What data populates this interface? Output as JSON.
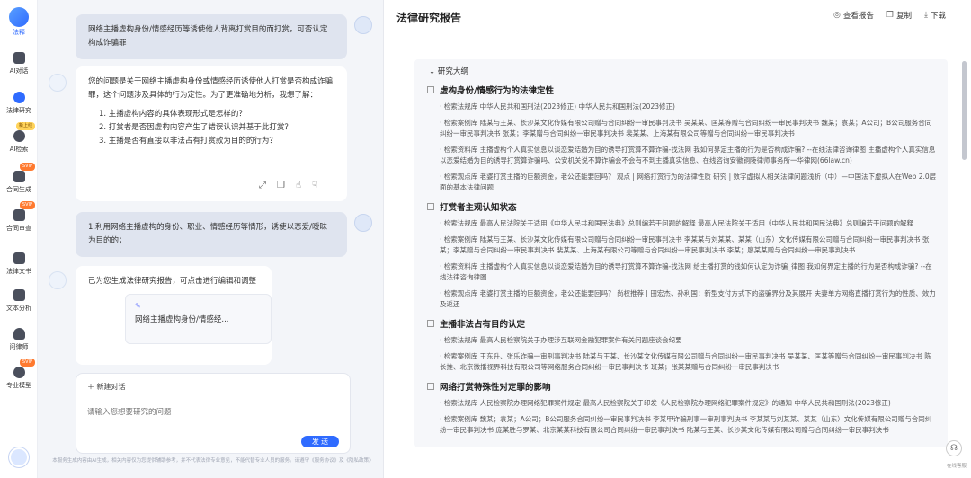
{
  "sidebar": {
    "logo_label": "法释",
    "items": [
      {
        "label": "AI对话",
        "icon": "chat-icon",
        "badge": ""
      },
      {
        "label": "法律研究",
        "icon": "research-icon",
        "badge": ""
      },
      {
        "label": "AI检索",
        "icon": "search-icon",
        "badge": "新上线"
      },
      {
        "label": "合同生成",
        "icon": "contract-gen-icon",
        "badge": "SVIP"
      },
      {
        "label": "合同审查",
        "icon": "contract-review-icon",
        "badge": "SVIP"
      },
      {
        "label": "法律文书",
        "icon": "document-icon",
        "badge": ""
      },
      {
        "label": "文本分析",
        "icon": "text-analysis-icon",
        "badge": ""
      },
      {
        "label": "问律师",
        "icon": "lawyer-icon",
        "badge": ""
      },
      {
        "label": "专业模型",
        "icon": "model-icon",
        "badge": "SVIP"
      }
    ]
  },
  "chat": {
    "user_msg_1": "网络主播虚构身份/情感经历等诱使他人背离打赏目的而打赏，可否认定构成诈骗罪",
    "bot_msg_1_intro": "您的问题是关于网络主播虚构身份或情感经历诱使他人打赏是否构成诈骗罪，这个问题涉及具体的行为定性。为了更准确地分析，我想了解：",
    "bot_msg_1_items": [
      "1. 主播虚构内容的具体表现形式是怎样的？",
      "2. 打赏者是否因虚构内容产生了错误认识并基于此打赏？",
      "3. 主播是否有直接以非法占有打赏款为目的的行为？"
    ],
    "user_msg_2": "1.利用网络主播虚构的身份、职业、情感经历等情形，诱使以恋爱/暧昧为目的的；",
    "bot_msg_2": "已为您生成法律研究报告，可点击进行编辑和调整",
    "card_title": "网络主播虚构身份/情感经...",
    "new_chat_label": "新建对话",
    "input_placeholder": "请输入您想要研究的问题",
    "send_label": "发 送",
    "disclaimer": "本服务生成内容由AI生成，相关内容仅为您提供辅助参考，并不代表法律专业意见，不能代替专业人员的服务。请遵守《服务协议》及《隐私政策》"
  },
  "report": {
    "title": "法律研究报告",
    "actions": {
      "view": "查看报告",
      "copy": "复制",
      "download": "下载"
    },
    "outline_label": "研究大纲",
    "sections": [
      {
        "heading": "虚构身份/情感行为的法律定性",
        "entries": [
          "· 检索法规库  中华人民共和国刑法(2023修正)  中华人民共和国刑法(2023修正)",
          "· 检索案例库  陆某与王某、长沙某文化传媒有限公司赠与合同纠纷一审民事判决书  吴某某、匡某等赠与合同纠纷一审民事判决书  魏某；袁某；A公司；B公司服务合同纠纷一审民事判决书  张某；李某赠与合同纠纷一审民事判决书  裴某某、上海某有限公司等赠与合同纠纷一审民事判决书",
          "· 检索资料库  主播虚构个人真实信息以谈恋爱结婚为目的诱导打赏算不算诈骗-找法网  我如何界定主播的行为是否构成诈骗? --在线法律咨询律图  主播虚构个人真实信息以恋爱结婚为目的诱导打赏算诈骗吗、公安机关说不算诈骗会不会有不到主播真实信息、在线咨询安徽铜陵律师事务所一华律网(66law.cn)",
          "· 检索观点库  老婆打赏主播的巨额资金，老公还能要回吗？  观点 | 网络打赏行为的法律性质  研究 | 数字虚拟人相关法律问题浅析（中）—中国法下虚拟人在Web 2.0层面的基本法律问题"
        ]
      },
      {
        "heading": "打赏者主观认知状态",
        "entries": [
          "· 检索法规库  最高人民法院关于适用《中华人民共和国民法典》总则编若干问题的解释  最高人民法院关于适用《中华人民共和国民法典》总则编若干问题的解释",
          "· 检索案例库  陆某与王某、长沙某文化传媒有限公司赠与合同纠纷一审民事判决书  李某某与刘某某、某某（山东）文化传媒有限公司赠与合同纠纷一审民事判决书  张某；李某赠与合同纠纷一审民事判决书  裴某某、上海某有限公司等赠与合同纠纷一审民事判决书  李某；廖某某赠与合同纠纷一审民事判决书",
          "· 检索资料库  主播虚构个人真实信息以谈恋爱结婚为目的诱导打赏算不算诈骗-找法网  给主播打赏的钱如何认定为诈骗_律图  我如何界定主播的行为是否构成诈骗? --在线法律咨询律图",
          "· 检索观点库  老婆打赏主播的巨额资金，老公还能要回吗？  尚权推荐 | 田宏杰、孙利国：新型支付方式下的盗骗界分及其展开  夫妻单方网络直播打赏行为的性质、效力及返还"
        ]
      },
      {
        "heading": "主播非法占有目的认定",
        "entries": [
          "· 检索法规库  最高人民检察院关于办理涉互联网金融犯罪案件有关问题座谈会纪要",
          "· 检索案例库  王东升、张乐诈骗一审刑事判决书  陆某与王某、长沙某文化传媒有限公司赠与合同纠纷一审民事判决书  吴某某、匡某等赠与合同纠纷一审民事判决书 陈长推、北京微播视界科技有限公司等网络服务合同纠纷一审民事判决书  班某；张某某赠与合同纠纷一审民事判决书"
        ]
      },
      {
        "heading": "网络打赏特殊性对定罪的影响",
        "entries": [
          "· 检索法规库  人民检察院办理网络犯罪案件规定  最高人民检察院关于印发《人民检察院办理网络犯罪案件规定》的通知  中华人民共和国刑法(2023修正)",
          "· 检索案例库  魏某；袁某；A公司；B公司服务合同纠纷一审民事判决书  李某甲诈骗刑事一审刑事判决书  李某某与刘某某、某某（山东）文化传媒有限公司赠与合同纠纷一审民事判决书  庞某胜与罗某、北京某某科技有限公司合同纠纷一审民事判决书  陆某与王某、长沙某文化传媒有限公司赠与合同纠纷一审民事判决书"
        ]
      }
    ],
    "float_label": "在线客服"
  }
}
